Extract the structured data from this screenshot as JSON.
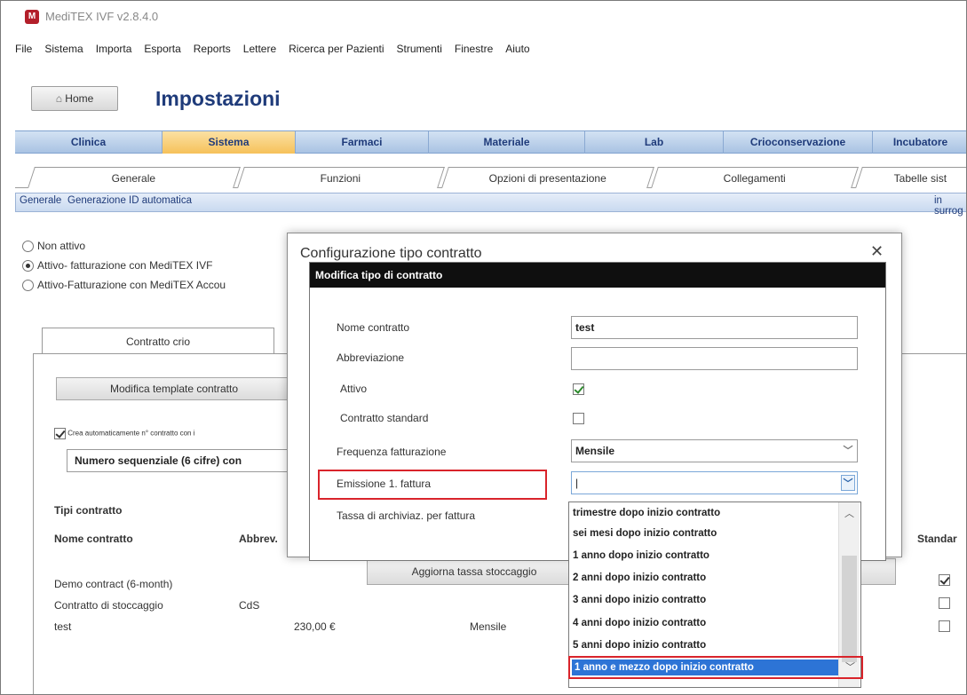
{
  "app": {
    "title": "MediTEX IVF v2.8.4.0",
    "icon_label": "M"
  },
  "menu": [
    "File",
    "Sistema",
    "Importa",
    "Esporta",
    "Reports",
    "Lettere",
    "Ricerca per Pazienti",
    "Strumenti",
    "Finestre",
    "Aiuto"
  ],
  "header": {
    "home_label": "Home",
    "home_icon": "house-icon",
    "page_title": "Impostazioni"
  },
  "main_tabs": [
    {
      "label": "Clinica"
    },
    {
      "label": "Sistema"
    },
    {
      "label": "Farmaci"
    },
    {
      "label": "Materiale"
    },
    {
      "label": "Lab"
    },
    {
      "label": "Crioconservazione"
    },
    {
      "label": "Incubatore"
    }
  ],
  "sub_tabs": [
    {
      "label": "Generale"
    },
    {
      "label": "Funzioni"
    },
    {
      "label": "Opzioni di presentazione"
    },
    {
      "label": "Collegamenti"
    },
    {
      "label": "Tabelle sist"
    }
  ],
  "third_tabs": {
    "left": [
      "Generale",
      "Generazione ID automatica"
    ],
    "right": "in surrog"
  },
  "billing_options": [
    {
      "label": "Non attivo",
      "selected": false
    },
    {
      "label": "Attivo- fatturazione con MediTEX IVF",
      "selected": true
    },
    {
      "label": "Attivo-Fatturazione con MediTEX Accou",
      "selected": false
    }
  ],
  "inner_tab": "Contratto crio",
  "buttons": {
    "edit_template": "Modifica template contratto",
    "update_storage_fee": "Aggiorna tassa stoccaggio"
  },
  "auto_contract": {
    "checkbox_label": "Crea automaticamente n° contratto con i",
    "checked": true,
    "format_value": "Numero sequenziale (6 cifre) con"
  },
  "contract_types": {
    "section_title": "Tipi contratto",
    "headers": [
      "Nome contratto",
      "Abbrev."
    ],
    "right_header": "Standar",
    "rows": [
      {
        "name": "Demo contract (6-month)",
        "abbrev": "",
        "fee": "",
        "freq": "",
        "standard": true
      },
      {
        "name": "Contratto di stoccaggio",
        "abbrev": "CdS",
        "fee": "",
        "freq": "",
        "standard": false
      },
      {
        "name": "test",
        "abbrev": "",
        "fee": "230,00 €",
        "freq": "Mensile",
        "standard": false
      }
    ]
  },
  "dialog": {
    "title": "Configurazione tipo contratto",
    "close_icon": "close-icon",
    "inner_title": "Modifica tipo di contratto",
    "fields": {
      "name_label": "Nome contratto",
      "name_value": "test",
      "abbrev_label": "Abbreviazione",
      "abbrev_value": "",
      "active_label": "Attivo",
      "active_checked": true,
      "standard_label": "Contratto standard",
      "standard_checked": false,
      "frequency_label": "Frequenza fatturazione",
      "frequency_value": "Mensile",
      "first_invoice_label": "Emissione 1. fattura",
      "first_invoice_value": "",
      "fee_label": "Tassa di archiviaz. per fattura"
    }
  },
  "first_invoice_options": [
    "trimestre dopo inizio contratto",
    "sei mesi dopo inizio contratto",
    "1 anno dopo inizio contratto",
    "2 anni dopo inizio contratto",
    "3 anni dopo inizio contratto",
    "4 anni dopo inizio contratto",
    "5 anni dopo inizio contratto"
  ],
  "first_invoice_selected": "1 anno e mezzo dopo inizio contratto",
  "colors": {
    "highlight": "#d9242b",
    "active_tab": "#f6c15a",
    "tab_blue": "#a9c3e3",
    "title_blue": "#1f3b7a",
    "selection": "#2d74d6"
  }
}
